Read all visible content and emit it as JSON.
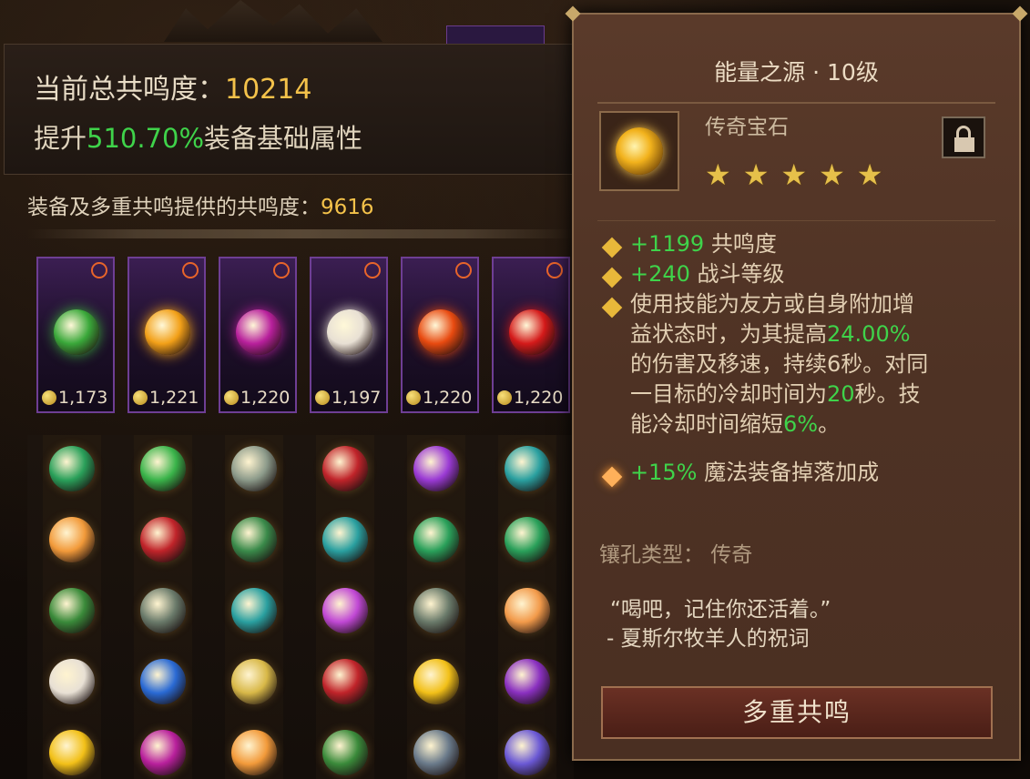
{
  "summary": {
    "title_label": "当前总共鸣度：",
    "title_value": "10214",
    "sub_prefix": "提升",
    "sub_pct": "510.70%",
    "sub_suffix": "装备基础属性",
    "contrib_label": "装备及多重共鸣提供的共鸣度：",
    "contrib_value": "9616"
  },
  "cards": [
    {
      "value": "1,173",
      "gem_color": "#3aa83a"
    },
    {
      "value": "1,221",
      "gem_color": "#f2a018"
    },
    {
      "value": "1,220",
      "gem_color": "#b8209c"
    },
    {
      "value": "1,197",
      "gem_color": "#e8e0d4"
    },
    {
      "value": "1,220",
      "gem_color": "#e84a10"
    },
    {
      "value": "1,220",
      "gem_color": "#d41a1a"
    }
  ],
  "gem_grid": [
    [
      "#2aa05a",
      "#3ab44a",
      "#8c9a8a",
      "#c0242a",
      "#9a3ad4",
      "#2aa0a0"
    ],
    [
      "#f29a3a",
      "#c0242a",
      "#3a8a4a",
      "#2aa0a0",
      "#2aa05a",
      "#2aa05a"
    ],
    [
      "#3a8a3a",
      "#6a7a6a",
      "#2aa0a0",
      "#c048d4",
      "#6a7a6a",
      "#f29a4a"
    ],
    [
      "#e8e0d4",
      "#2a6ad4",
      "#d8b848",
      "#c0242a",
      "#f2c018",
      "#8a30c0"
    ],
    [
      "#f2c018",
      "#b8209c",
      "#f29a3a",
      "#3a8a3a",
      "#6a7a8a",
      "#6a58d4"
    ]
  ],
  "tooltip": {
    "title": "能量之源 · 10级",
    "gem_type": "传奇宝石",
    "stars": [
      "★",
      "★",
      "★",
      "★",
      "★"
    ],
    "lines": [
      {
        "g": "+1199",
        "t": " 共鸣度"
      },
      {
        "g": "+240",
        "t": " 战斗等级"
      },
      {
        "t": "使用技能为友方或自身附加增"
      },
      {
        "t": "益状态时，为其提高",
        "g2": "24.00%"
      },
      {
        "t": "的伤害及移速，持续6秒。对同"
      },
      {
        "t": "一目标的冷却时间为",
        "g2": "20",
        "t2": "秒。技"
      },
      {
        "t": "能冷却时间缩短",
        "g2": "6%",
        "t2": "。"
      },
      {
        "g": "+15%",
        "t": " 魔法装备掉落加成"
      }
    ],
    "socket": "镶孔类型：  传奇",
    "quote": "“喝吧，记住你还活着。”",
    "author": "- 夏斯尔牧羊人的祝词",
    "button": "多重共鸣"
  },
  "icons": {
    "lock": "lock-icon",
    "rank": "rank-emblem-icon",
    "coin": "coin-icon",
    "bullet": "diamond-bullet-icon"
  }
}
